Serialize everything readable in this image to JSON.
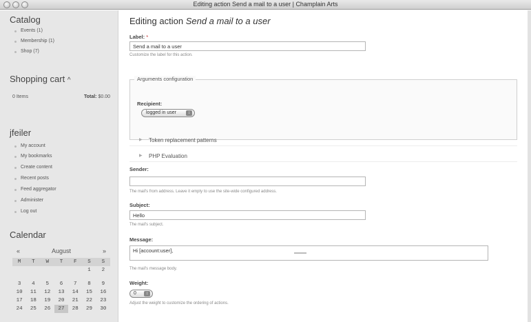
{
  "window": {
    "title": "Editing action Send a mail to a user | Champlain Arts"
  },
  "sidebar": {
    "catalog": {
      "title": "Catalog",
      "items": [
        "Events (1)",
        "Membership (1)",
        "Shop (7)"
      ]
    },
    "cart": {
      "title": "Shopping cart",
      "toggle": "^",
      "items": "0 Items",
      "total_label": "Total:",
      "total_value": "$0.00"
    },
    "user": {
      "title": "jfeiler",
      "items": [
        "My account",
        "My bookmarks",
        "Create content",
        "Recent posts",
        "Feed aggregator",
        "Administer",
        "Log out"
      ]
    },
    "calendar": {
      "title": "Calendar",
      "prev": "«",
      "month": "August",
      "next": "»",
      "weekdays": [
        "M",
        "T",
        "W",
        "T",
        "F",
        "S",
        "S"
      ],
      "weeks": [
        [
          "",
          "",
          "",
          "",
          "",
          "1",
          "2"
        ],
        [
          "3",
          "4",
          "5",
          "6",
          "7",
          "8",
          "9"
        ],
        [
          "10",
          "11",
          "12",
          "13",
          "14",
          "15",
          "16"
        ],
        [
          "17",
          "18",
          "19",
          "20",
          "21",
          "22",
          "23"
        ],
        [
          "24",
          "25",
          "26",
          "27",
          "28",
          "29",
          "30"
        ]
      ],
      "today": "27"
    }
  },
  "main": {
    "title_prefix": "Editing action",
    "title_name": "Send a mail to a user",
    "label": {
      "label": "Label:",
      "required": "*",
      "value": "Send a mail to a user",
      "desc": "Customize the label for this action."
    },
    "arguments": {
      "legend": "Arguments configuration",
      "recipient_label": "Recipient:",
      "recipient_value": "logged in user"
    },
    "token_patterns": "Token replacement patterns",
    "php_eval": "PHP Evaluation",
    "sender": {
      "label": "Sender:",
      "value": "",
      "desc": "The mail's from address. Leave it empty to use the site-wide configured address."
    },
    "subject": {
      "label": "Subject:",
      "value": "Hello",
      "desc": "The mail's subject."
    },
    "message": {
      "label": "Message:",
      "value": "Hi [account:user],",
      "desc": "The mail's message body."
    },
    "weight": {
      "label": "Weight:",
      "value": "0",
      "desc": "Adjust the weight to customize the ordering of actions."
    }
  }
}
